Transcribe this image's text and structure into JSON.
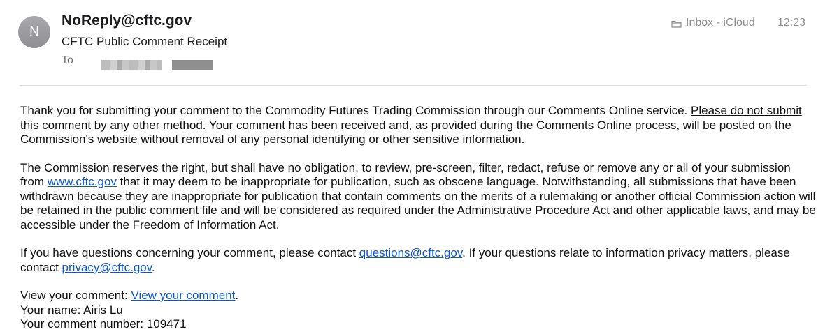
{
  "header": {
    "avatar_initial": "N",
    "sender": "NoReply@cftc.gov",
    "subject": "CFTC Public Comment Receipt",
    "to_label": "To",
    "mailbox": "Inbox - iCloud",
    "time": "12:23"
  },
  "body": {
    "p1_start": "Thank you for submitting your comment to the Commodity Futures Trading Commission through our Comments Online service. ",
    "p1_underlined": "Please do not submit this comment by any other method",
    "p1_end": ". Your comment has been received and, as provided during the Comments Online process, will be posted on the Commission's website without removal of any personal identifying or other sensitive information.",
    "p2_start": "The Commission reserves the right, but shall have no obligation, to review, pre-screen, filter, redact, refuse or remove any or all of your submission from ",
    "p2_link": "www.cftc.gov",
    "p2_end": " that it may deem to be inappropriate for publication, such as obscene language. Notwithstanding, all submissions that have been withdrawn because they are inappropriate for publication that contain comments on the merits of a rulemaking or another official Commission action will be retained in the public comment file and will be considered as required under the Administrative Procedure Act and other applicable laws, and may be accessible under the Freedom of Information Act.",
    "p3_start": "If you have questions concerning your comment, please contact ",
    "p3_link1": "questions@cftc.gov",
    "p3_mid": ". If your questions relate to information privacy matters, please contact ",
    "p3_link2": "privacy@cftc.gov",
    "p3_end": ".",
    "view_label": "View your comment: ",
    "view_link": "View your comment",
    "view_end": ".",
    "name_line": "Your name: Airis Lu",
    "number_line": "Your comment number: 109471"
  },
  "colors": {
    "link": "#0b57d0",
    "avatar": "#9a9aa0",
    "meta_text": "#8e8e93"
  }
}
